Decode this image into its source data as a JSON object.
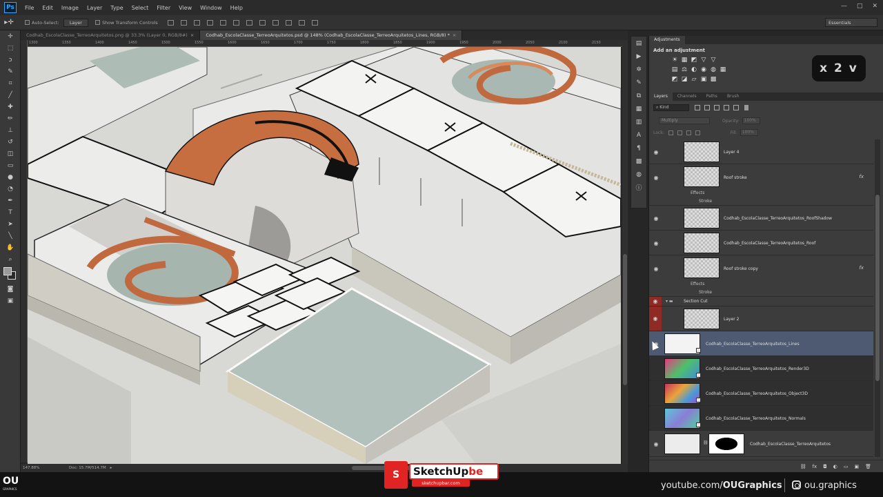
{
  "app": {
    "logo": "Ps",
    "menu": [
      "File",
      "Edit",
      "Image",
      "Layer",
      "Type",
      "Select",
      "Filter",
      "View",
      "Window",
      "Help"
    ],
    "window_controls": [
      "—",
      "□",
      "✕"
    ]
  },
  "options_bar": {
    "auto_select_label": "Auto-Select:",
    "auto_select_value": "Layer",
    "transform_label": "Show Transform Controls",
    "workspace": "Essentials"
  },
  "tabs": [
    {
      "label": "Codhab_EscolaClasse_TerreoArquitetos.png @ 33.3% (Layer 0, RGB/8#)",
      "active": false
    },
    {
      "label": "Codhab_EscolaClasse_TerreoArquitetos.psd @ 148% (Codhab_EscolaClasse_TerreoArquitetos_Lines, RGB/8) *",
      "active": true
    }
  ],
  "ruler_ticks": [
    "1300",
    "1350",
    "1400",
    "1450",
    "1500",
    "1550",
    "1600",
    "1650",
    "1700",
    "1750",
    "1800",
    "1850",
    "1900",
    "1950",
    "2000",
    "2050",
    "2100",
    "2150"
  ],
  "status": {
    "zoom": "147.88%",
    "doc": "Doc: 15.7M/514.7M"
  },
  "adjustments": {
    "panel_tab": "Adjustments",
    "title": "Add an adjustment",
    "row1": [
      "☀",
      "▦",
      "◩",
      "▽",
      "▽"
    ],
    "row2": [
      "▤",
      "⚖",
      "◐",
      "◉",
      "◍",
      "▦"
    ],
    "row3": [
      "◩",
      "◪",
      "▱",
      "▣",
      "▩"
    ]
  },
  "speed_badge": "x 2 v",
  "layers_panel": {
    "tabs": [
      "Layers",
      "Channels",
      "Paths",
      "Brush"
    ],
    "filter_kind": "⌕ Kind",
    "blend_mode": "Multiply",
    "opacity_label": "Opacity:",
    "opacity_value": "100%",
    "lock_label": "Lock:",
    "fill_label": "Fill:",
    "fill_value": "100%",
    "layers": [
      {
        "name": "Layer 4",
        "visible": true
      },
      {
        "name": "Roof stroke",
        "visible": true,
        "fx": "fx"
      },
      {
        "name": "Codhab_EscolaClasse_TerreoArquitetos_RoofShadow",
        "visible": true
      },
      {
        "name": "Codhab_EscolaClasse_TerreoArquitetos_Roof",
        "visible": true
      },
      {
        "name": "Roof stroke copy",
        "visible": true,
        "fx": "fx"
      },
      {
        "name": "Section Cut",
        "visible": true,
        "group": true
      },
      {
        "name": "Layer 2",
        "visible": true
      },
      {
        "name": "Codhab_EscolaClasse_TerreoArquitetos_Lines",
        "visible": true,
        "selected": true
      },
      {
        "name": "Codhab_EscolaClasse_TerreoArquitetos_Render3D",
        "visible": false
      },
      {
        "name": "Codhab_EscolaClasse_TerreoArquitetos_Object3D",
        "visible": false
      },
      {
        "name": "Codhab_EscolaClasse_TerreoArquitetos_Normals",
        "visible": false
      },
      {
        "name": "Codhab_EscolaClasse_TerreoArquitetos",
        "visible": true
      }
    ],
    "effects_label": "Effects",
    "stroke_label": "Stroke",
    "footer": [
      "⛓",
      "fx",
      "◘",
      "◐",
      "▭",
      "▣",
      "🗑"
    ]
  },
  "branding": {
    "channel": "youtube.com/OUGraphics",
    "channel_prefix": "youtube.com/",
    "channel_name": "OUGraphics",
    "instagram": "ou.graphics",
    "ou_logo": "OU",
    "ou_sub": "GRAPHICS",
    "sketchup": "SketchUp",
    "sketchup_suffix": "be",
    "sketchup_url": "sketchupbar.com",
    "sketchup_box": "S"
  }
}
